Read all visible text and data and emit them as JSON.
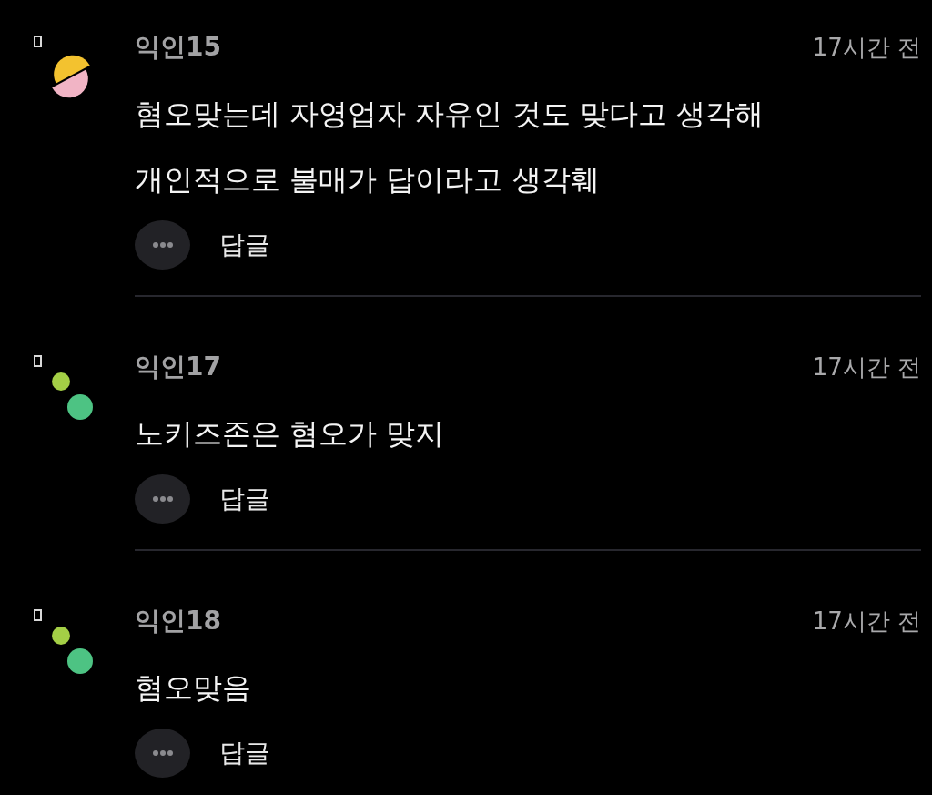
{
  "comments": [
    {
      "author": "익인15",
      "time": "17시간 전",
      "avatar": {
        "kind": "halves"
      },
      "lines": [
        "혐오맞는데 자영업자 자유인 것도 맞다고 생각해",
        "개인적으로 불매가 답이라고 생각훼"
      ],
      "reply_label": "답글"
    },
    {
      "author": "익인17",
      "time": "17시간 전",
      "avatar": {
        "kind": "dots"
      },
      "lines": [
        "노키즈존은 혐오가 맞지"
      ],
      "reply_label": "답글"
    },
    {
      "author": "익인18",
      "time": "17시간 전",
      "avatar": {
        "kind": "dots"
      },
      "lines": [
        "혐오맞음"
      ],
      "reply_label": "답글"
    }
  ]
}
